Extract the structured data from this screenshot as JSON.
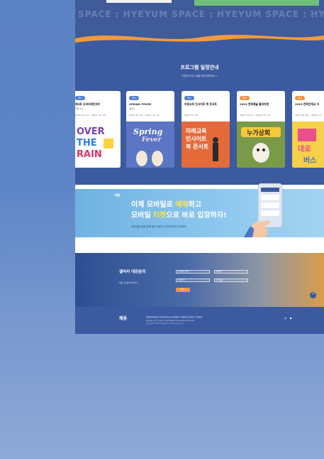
{
  "hero": {
    "marquee": "SPACE : HYEYUM SPACE : HYEYUM SPACE : HYEYU"
  },
  "program": {
    "title": "프로그램 일정안내",
    "subtitle": "다양한 프로그램을 확인해보세요 :)",
    "cards": [
      {
        "badge": "전시",
        "badge_color": "blue",
        "title": "제5회 오버더레인보우",
        "date": "2023. 09. 27 ~ 2023. 11. 30",
        "sub": "작품 전시",
        "poster": "OVER THE RAIN"
      },
      {
        "badge": "전시",
        "badge_color": "blue",
        "title": "SPRING FEVER",
        "date": "2023. 09. 27 ~ 2023. 11. 30",
        "sub": "봄전시",
        "poster": "Spring Fever"
      },
      {
        "badge": "전시",
        "badge_color": "blue",
        "title": "미래교육 인사이트 북 콘서트",
        "date": "2023. 07. 26",
        "sub": "",
        "poster": "미래교육 인사이트 북 콘서트"
      },
      {
        "badge": "행사",
        "badge_color": "orange",
        "title": "2023 한화예술 플리마켓",
        "date": "2023. 09. 21 ~ 2023. 09. 23",
        "sub": "",
        "poster": "누가상회"
      },
      {
        "badge": "전시",
        "badge_color": "orange",
        "title": "2023 한화인재교 자",
        "date": "2023. 04. 05 ~ 2023. 11.",
        "sub": "",
        "poster": "미술 대로 버스"
      }
    ]
  },
  "mobile": {
    "logo": "혜윰",
    "line1_a": "이제 모바일로 ",
    "line1_hl": "예매",
    "line1_b": "하고",
    "line2_a": "모바일 ",
    "line2_hl": "티켓",
    "line2_b": "으로 바로 입장하자!",
    "desc": "공간예움 앱을 통해 줄서지말고 간편하게 만나보세요!"
  },
  "rental": {
    "title": "갤러리 대관문의",
    "subtitle": "대관 안내와 문의하기",
    "fields": [
      "전화번호 입력",
      "이메일",
      "이름입력",
      "문의내용"
    ],
    "button": "대관문의"
  },
  "footer": {
    "logo": "혜윰",
    "links": "개인정보처리방침 | 영상정보처리기기운영방침 | 이메일무단수집거부 | 이용약관",
    "info": "서울특별시 종로구 대표번호 02-000-0000 / hyeyum@example.com",
    "copy": "Copyright © HYEYUM SPACE All Rights Reserved."
  },
  "colors": {
    "brand_blue": "#3b5a9f",
    "accent_orange": "#f0933a",
    "highlight_yellow": "#ffe14a"
  }
}
